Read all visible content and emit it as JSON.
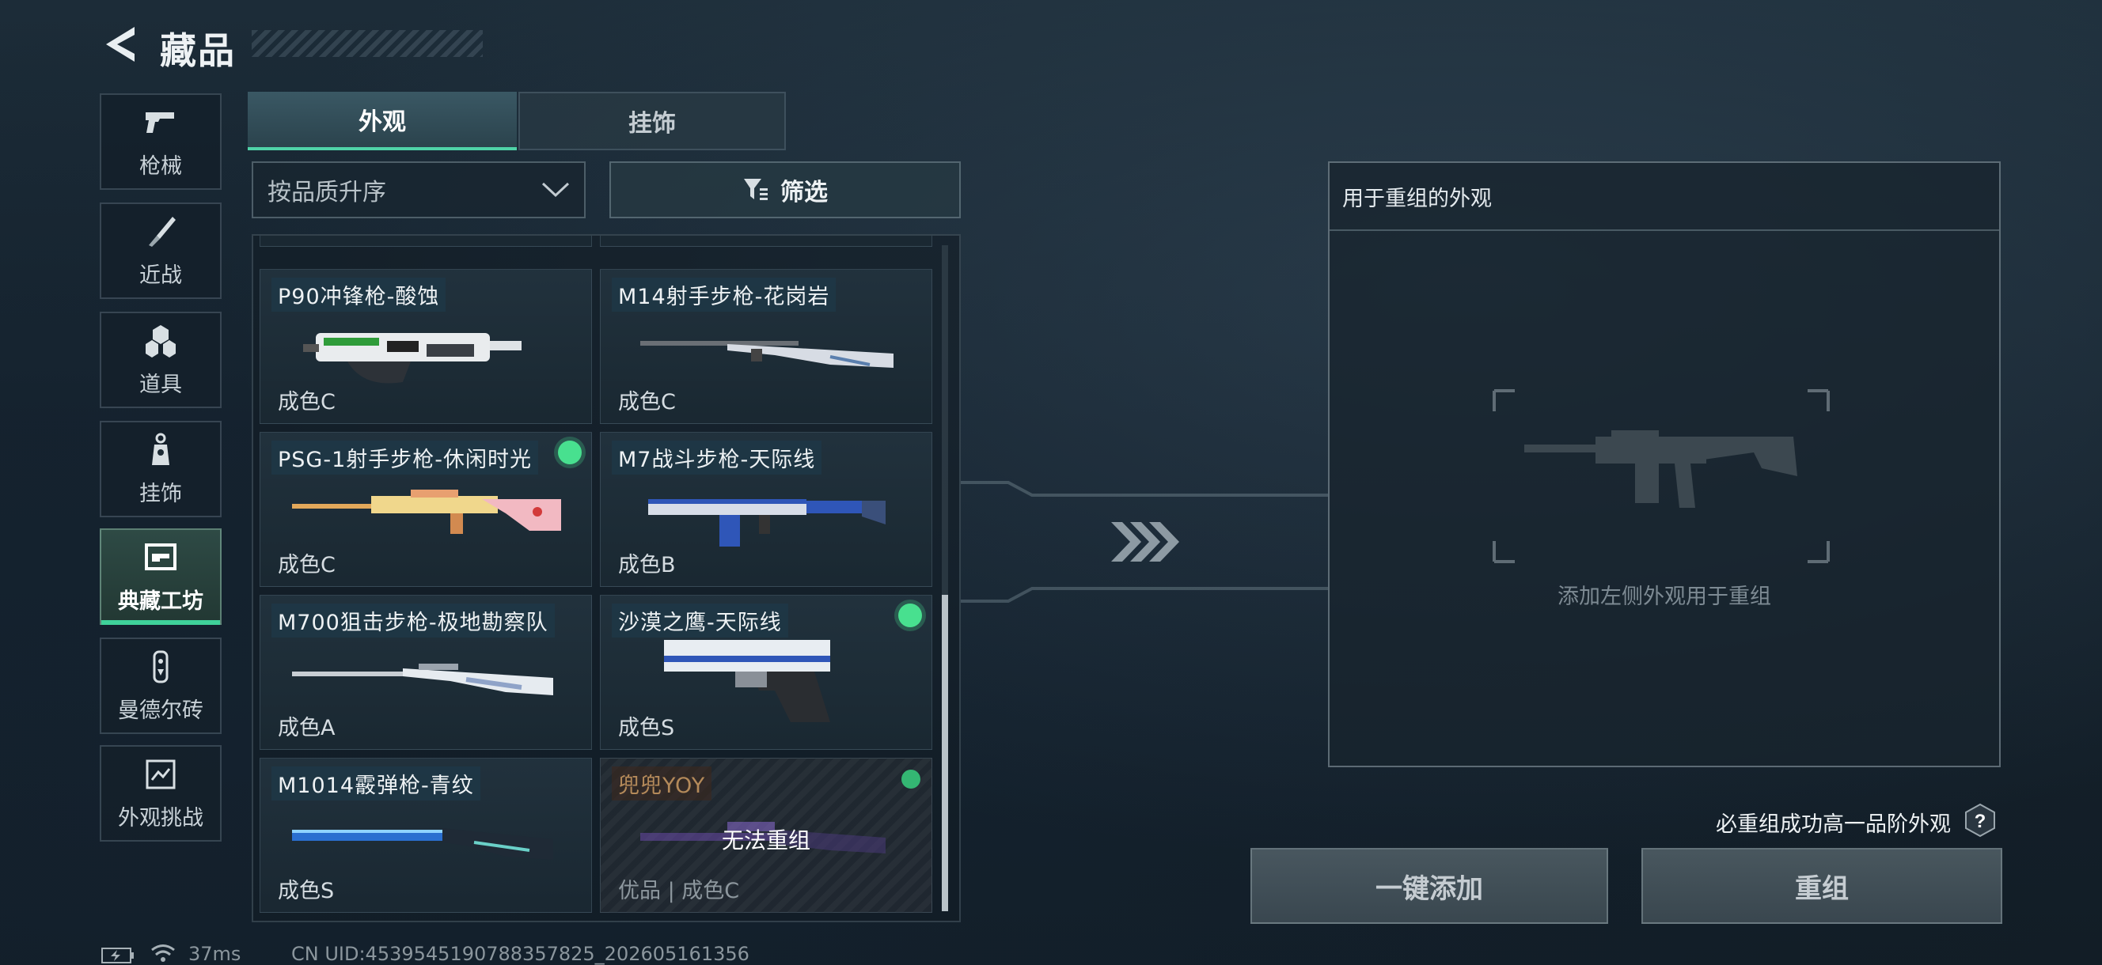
{
  "header": {
    "title": "藏品"
  },
  "categories": [
    {
      "label": "枪械",
      "icon": "pistol-icon"
    },
    {
      "label": "近战",
      "icon": "knife-icon"
    },
    {
      "label": "道具",
      "icon": "grenade-icon"
    },
    {
      "label": "挂饰",
      "icon": "charm-icon"
    },
    {
      "label": "典藏工坊",
      "icon": "workshop-icon",
      "active": true
    },
    {
      "label": "曼德尔砖",
      "icon": "brick-icon"
    },
    {
      "label": "外观挑战",
      "icon": "challenge-icon"
    }
  ],
  "tabs": [
    {
      "label": "外观",
      "active": true
    },
    {
      "label": "挂饰",
      "active": false
    }
  ],
  "sort": {
    "label": "按品质升序"
  },
  "filter": {
    "label": "筛选"
  },
  "items": [
    {
      "name": "P90冲锋枪-酸蚀",
      "grade": "成色C",
      "selected": false,
      "accent": "#2f9c3a"
    },
    {
      "name": "M14射手步枪-花岗岩",
      "grade": "成色C",
      "selected": false,
      "accent": "#5a7fae"
    },
    {
      "name": "PSG-1射手步枪-休闲时光",
      "grade": "成色C",
      "selected": true,
      "accent": "#e3a85a"
    },
    {
      "name": "M7战斗步枪-天际线",
      "grade": "成色B",
      "selected": false,
      "accent": "#2f56b8"
    },
    {
      "name": "M700狙击步枪-极地勘察队",
      "grade": "成色A",
      "selected": false,
      "accent": "#8fa3c8"
    },
    {
      "name": "沙漠之鹰-天际线",
      "grade": "成色S",
      "selected": true,
      "accent": "#2f56b8"
    },
    {
      "name": "M1014霰弹枪-青纹",
      "grade": "成色S",
      "selected": false,
      "accent": "#2a6fd0"
    },
    {
      "name": "兜兜YOY",
      "grade": "优品 | 成色C",
      "selected": true,
      "locked": true,
      "overlay": "无法重组",
      "accent": "#6a4aa8"
    }
  ],
  "panel": {
    "title": "用于重组的外观",
    "hint": "添加左侧外观用于重组"
  },
  "guarantee": "必重组成功高一品阶外观",
  "buttons": {
    "add_all": "一键添加",
    "reforge": "重组"
  },
  "footer": {
    "ping": "37ms",
    "uid": "CN UID:4539545190788357825_202605161356"
  },
  "colors": {
    "accent_green": "#48e08f",
    "background": "#15222d"
  }
}
